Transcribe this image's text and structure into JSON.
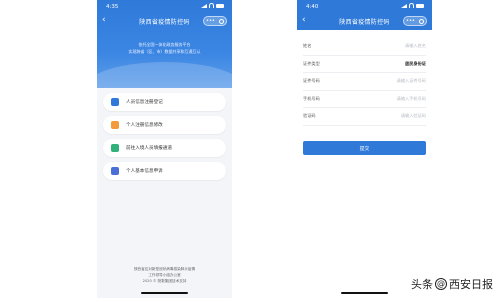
{
  "left": {
    "status": {
      "time": "4:35"
    },
    "nav": {
      "back": "‹",
      "title": "陕西省疫情防控码",
      "capsule_more": "•••"
    },
    "hero_lines": [
      "依托全国一体化政务服务平台",
      "实现跨省（区、市）数据共享和互通互认"
    ],
    "menu": [
      {
        "label": "人员信息注册登记",
        "icon": "document-icon",
        "color": "#2f7ad9"
      },
      {
        "label": "个人注册信息修改",
        "icon": "edit-card-icon",
        "color": "#f39a3d"
      },
      {
        "label": "前往入境人员填报通道",
        "icon": "plane-icon",
        "color": "#30b27a"
      },
      {
        "label": "个人基本信息申诉",
        "icon": "appeal-icon",
        "color": "#4a6fd6"
      }
    ],
    "footer_lines": [
      "陕西省应对新型冠状病毒感染肺炎疫情",
      "工作领导小组办公室",
      "2020 © 陕数集团技术支持"
    ]
  },
  "right": {
    "status": {
      "time": "4:40"
    },
    "nav": {
      "back": "‹",
      "title": "陕西省疫情防控码",
      "capsule_more": "•••"
    },
    "fields": [
      {
        "label": "姓名",
        "value": "请输入姓名",
        "filled": false
      },
      {
        "label": "证件类型",
        "value": "居民身份证",
        "filled": true
      },
      {
        "label": "证件号码",
        "value": "请输入证件号码",
        "filled": false
      },
      {
        "label": "手机号码",
        "value": "请输入手机号码",
        "filled": false
      },
      {
        "label": "验证码",
        "value": "请输入验证码",
        "filled": false
      }
    ],
    "submit_label": "提交"
  },
  "watermark": {
    "prefix": "头条",
    "at": "@",
    "name": "西安日报"
  },
  "colors": {
    "primary": "#2f7ad9"
  }
}
